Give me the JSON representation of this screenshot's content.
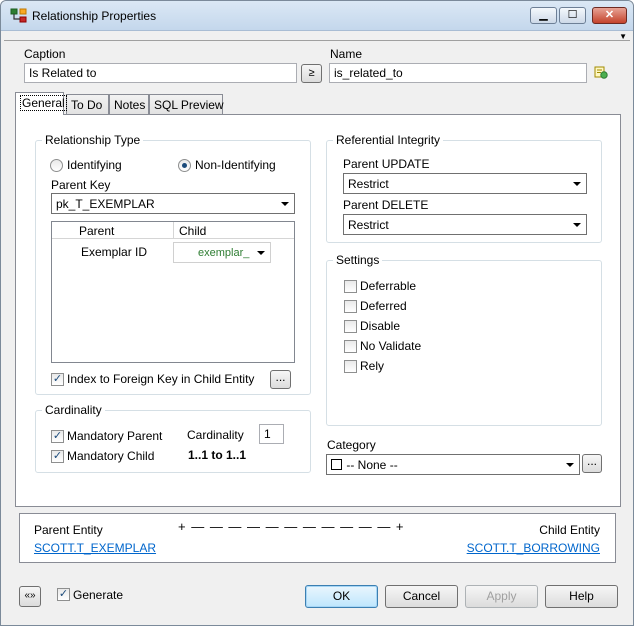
{
  "window": {
    "title": "Relationship Properties",
    "min_icon": "minimize-icon",
    "max_icon": "maximize-icon",
    "close_icon": "close-icon"
  },
  "caption": {
    "label": "Caption",
    "value": "Is Related to",
    "goto_label": "≥"
  },
  "name": {
    "label": "Name",
    "value": "is_related_to",
    "icon": "naming-options-icon"
  },
  "tabs": [
    {
      "label": "General",
      "active": true
    },
    {
      "label": "To Do"
    },
    {
      "label": "Notes"
    },
    {
      "label": "SQL Preview"
    }
  ],
  "relationship_type": {
    "title": "Relationship Type",
    "identifying": "Identifying",
    "non_identifying": "Non-Identifying",
    "selected": "Non-Identifying",
    "parent_key_label": "Parent Key",
    "parent_key_value": "pk_T_EXEMPLAR",
    "columns": {
      "parent": "Parent",
      "child": "Child"
    },
    "rows": [
      {
        "parent": "Exemplar ID",
        "child": "exemplar_id"
      }
    ],
    "index_fk_label": "Index to Foreign Key in Child Entity",
    "index_fk_checked": true,
    "ellipsis": "..."
  },
  "referential_integrity": {
    "title": "Referential Integrity",
    "parent_update_label": "Parent UPDATE",
    "parent_update_value": "Restrict",
    "parent_delete_label": "Parent DELETE",
    "parent_delete_value": "Restrict"
  },
  "settings": {
    "title": "Settings",
    "items": [
      {
        "label": "Deferrable",
        "checked": false
      },
      {
        "label": "Deferred",
        "checked": false
      },
      {
        "label": "Disable",
        "checked": false
      },
      {
        "label": "No Validate",
        "checked": false
      },
      {
        "label": "Rely",
        "checked": false
      }
    ]
  },
  "cardinality": {
    "title": "Cardinality",
    "mandatory_parent": "Mandatory Parent",
    "mandatory_child": "Mandatory Child",
    "cardinality_label": "Cardinality",
    "cardinality_value": "1",
    "summary": "1..1 to 1..1"
  },
  "category": {
    "label": "Category",
    "value": "-- None --",
    "ellipsis": "..."
  },
  "entities": {
    "parent_label": "Parent Entity",
    "parent_link": "SCOTT.T_EXEMPLAR",
    "child_label": "Child Entity",
    "child_link": "SCOTT.T_BORROWING",
    "connector": "+ — — — — — — — — — — — +"
  },
  "footer": {
    "generate_label": "Generate",
    "generate_checked": true,
    "ok": "OK",
    "cancel": "Cancel",
    "apply": "Apply",
    "help": "Help",
    "toggle_icon": "expand-collapse-icon"
  }
}
